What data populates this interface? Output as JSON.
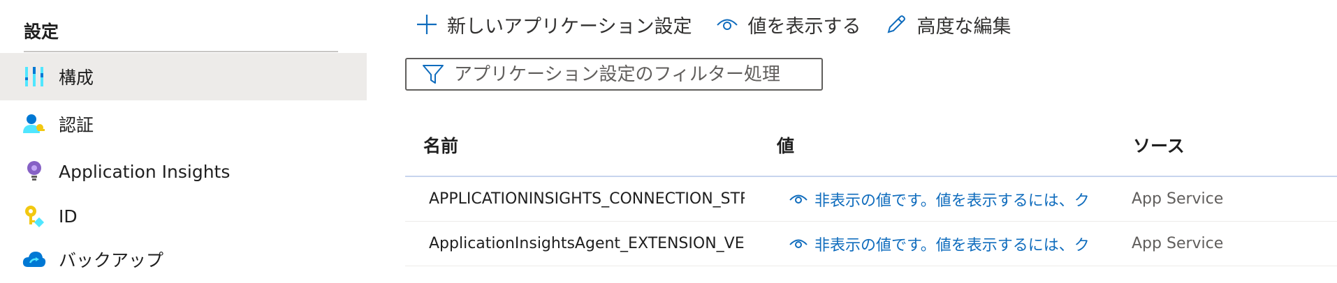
{
  "sidebar": {
    "section_title": "設定",
    "items": [
      {
        "label": "構成",
        "icon": "configuration-icon",
        "selected": true
      },
      {
        "label": "認証",
        "icon": "authentication-icon",
        "selected": false
      },
      {
        "label": "Application Insights",
        "icon": "application-insights-icon",
        "selected": false
      },
      {
        "label": "ID",
        "icon": "identity-key-icon",
        "selected": false
      },
      {
        "label": "バックアップ",
        "icon": "backup-cloud-icon",
        "selected": false
      }
    ]
  },
  "toolbar": {
    "new_setting_label": "新しいアプリケーション設定",
    "show_values_label": "値を表示する",
    "advanced_edit_label": "高度な編集"
  },
  "filter": {
    "placeholder": "アプリケーション設定のフィルター処理"
  },
  "table": {
    "headers": {
      "name": "名前",
      "value": "値",
      "source": "ソース"
    },
    "rows": [
      {
        "name": "APPLICATIONINSIGHTS_CONNECTION_STRIN",
        "value": "非表示の値です。値を表示するには、ク",
        "source": "App Service"
      },
      {
        "name": "ApplicationInsightsAgent_EXTENSION_VERSI",
        "value": "非表示の値です。値を表示するには、ク",
        "source": "App Service"
      }
    ]
  },
  "colors": {
    "accent": "#0f6cbd",
    "selected_bg": "#edebe9",
    "icon_blue": "#0078d4"
  }
}
